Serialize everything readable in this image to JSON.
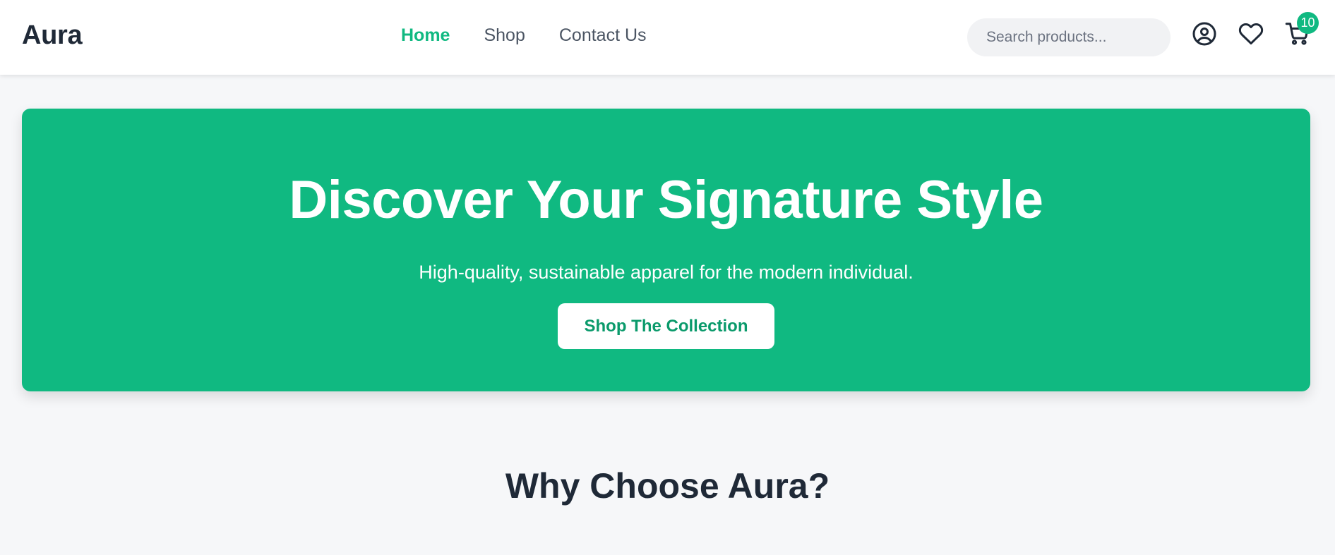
{
  "header": {
    "brand": "Aura",
    "nav": [
      {
        "label": "Home",
        "active": true
      },
      {
        "label": "Shop",
        "active": false
      },
      {
        "label": "Contact Us",
        "active": false
      }
    ],
    "search": {
      "placeholder": "Search products...",
      "value": ""
    },
    "icons": {
      "account": "user-circle-icon",
      "wishlist": "heart-icon",
      "cart": "cart-icon"
    },
    "cart_count": "10"
  },
  "hero": {
    "title": "Discover Your Signature Style",
    "subtitle": "High-quality, sustainable apparel for the modern individual.",
    "cta_label": "Shop The Collection"
  },
  "section": {
    "title": "Why Choose Aura?"
  },
  "colors": {
    "accent": "#10b981",
    "text_dark": "#1f2937",
    "background": "#f6f7f9"
  }
}
